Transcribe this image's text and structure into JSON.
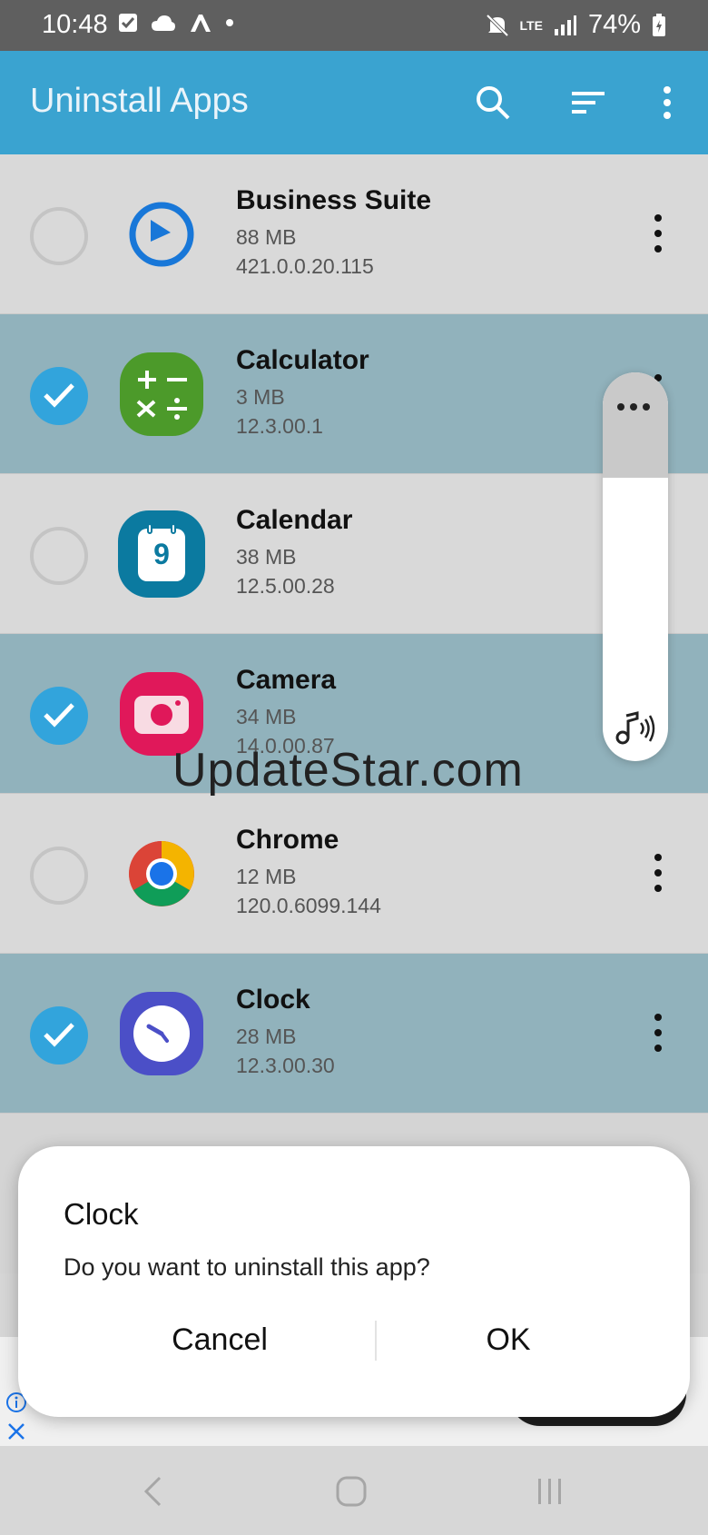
{
  "status_bar": {
    "time": "10:48",
    "battery": "74%",
    "network": "LTE"
  },
  "app_bar": {
    "title": "Uninstall Apps"
  },
  "apps": [
    {
      "name": "Business Suite",
      "size": "88 MB",
      "version": "421.0.0.20.115",
      "selected": false
    },
    {
      "name": "Calculator",
      "size": "3 MB",
      "version": "12.3.00.1",
      "selected": true
    },
    {
      "name": "Calendar",
      "size": "38 MB",
      "version": "12.5.00.28",
      "selected": false
    },
    {
      "name": "Camera",
      "size": "34 MB",
      "version": "14.0.00.87",
      "selected": true
    },
    {
      "name": "Chrome",
      "size": "12 MB",
      "version": "120.0.6099.144",
      "selected": false
    },
    {
      "name": "Clock",
      "size": "28 MB",
      "version": "12.3.00.30",
      "selected": true
    }
  ],
  "calendar_icon_day": "9",
  "watermark": "UpdateStar.com",
  "dialog": {
    "title": "Clock",
    "message": "Do you want to uninstall this app?",
    "cancel_label": "Cancel",
    "ok_label": "OK"
  },
  "colors": {
    "app_bar": "#3aa3d0",
    "selected_row": "#91b2bc",
    "checkbox_checked": "#32a4dc"
  }
}
